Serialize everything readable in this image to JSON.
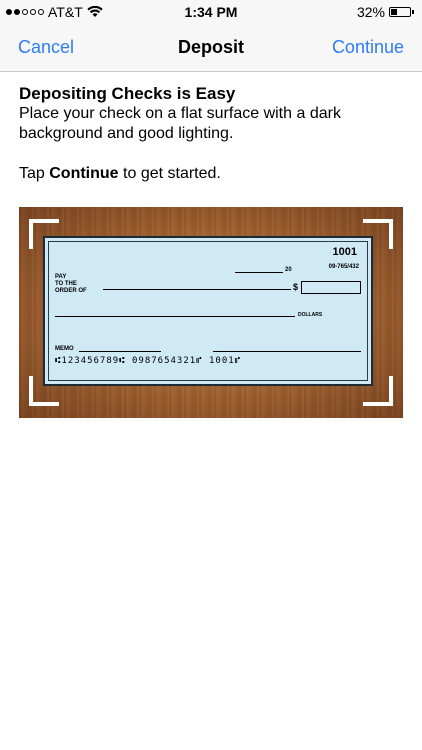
{
  "status_bar": {
    "carrier": "AT&T",
    "time": "1:34 PM",
    "battery_text": "32%",
    "battery_level": 0.32,
    "signal_dots_filled": 2,
    "signal_dots_total": 5,
    "icons": [
      "signal-dots-icon",
      "wifi-icon",
      "battery-icon"
    ]
  },
  "nav": {
    "left_label": "Cancel",
    "title": "Deposit",
    "right_label": "Continue",
    "accent_color": "#2f7cf6"
  },
  "content": {
    "heading": "Depositing Checks is Easy",
    "instructions": "Place your check on a flat surface with a dark background and good lighting.",
    "tap_prefix": "Tap ",
    "tap_bold": "Continue",
    "tap_suffix": " to get started."
  },
  "check": {
    "number": "1001",
    "date_suffix": "20",
    "routing_fraction": "09-765/432",
    "pay_label_1": "PAY",
    "pay_label_2": "TO THE",
    "pay_label_3": "ORDER OF",
    "dollar_sign": "$",
    "dollars_label": "DOLLARS",
    "memo_label": "MEMO",
    "micr_line": "⑆123456789⑆  0987654321⑈  1001⑈"
  }
}
